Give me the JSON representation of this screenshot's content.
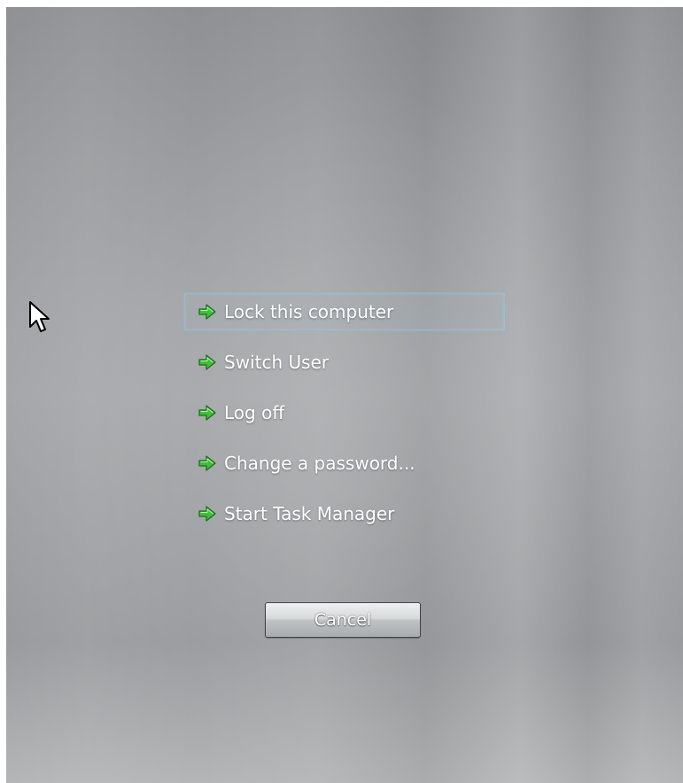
{
  "screen": {
    "title": "",
    "background_color": "#a0a2a5"
  },
  "options": [
    {
      "label": "Lock this computer",
      "icon": "green-arrow-icon",
      "focused": true
    },
    {
      "label": "Switch User",
      "icon": "green-arrow-icon",
      "focused": false
    },
    {
      "label": "Log off",
      "icon": "green-arrow-icon",
      "focused": false
    },
    {
      "label": "Change a password...",
      "icon": "green-arrow-icon",
      "focused": false
    },
    {
      "label": "Start Task Manager",
      "icon": "green-arrow-icon",
      "focused": false
    }
  ],
  "cancel_button": {
    "label": "Cancel"
  },
  "colors": {
    "arrow_green": "#3fbf3a",
    "focus_border": "#78bedc",
    "text": "#ffffff"
  },
  "cursor": {
    "icon": "mouse-pointer-icon"
  }
}
